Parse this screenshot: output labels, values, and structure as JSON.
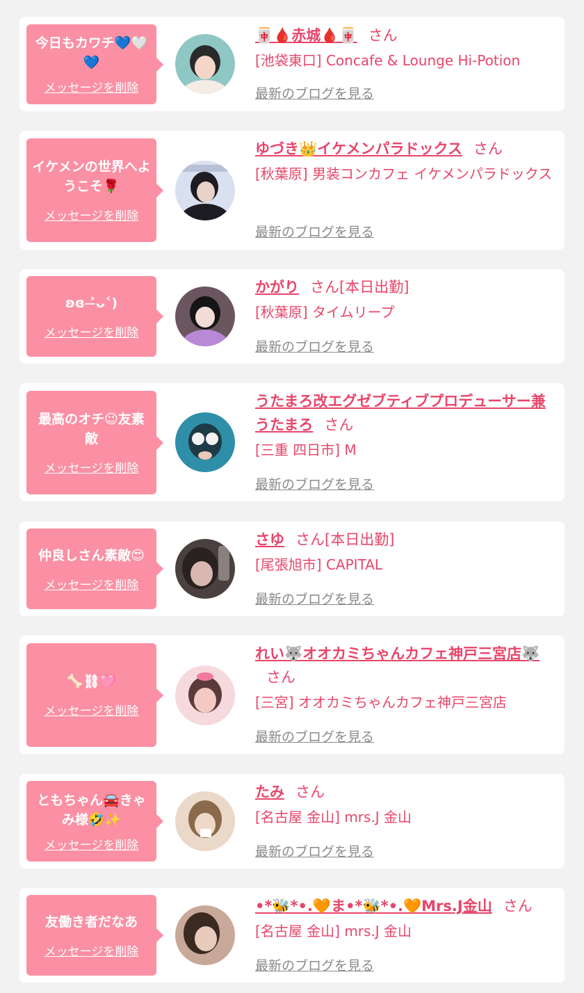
{
  "items": [
    {
      "message": "今日もカワチ💙🤍💙",
      "delete_label": "メッセージを削除",
      "name": "🀄🩸赤城🩸🀄",
      "honorific": "さん",
      "status": "",
      "shop": "[池袋東口] Concafe & Lounge Hi-Potion",
      "blog_label": "最新のブログを見る",
      "avatar_colors": [
        "#8fc7c4",
        "#2a2a2a",
        "#f3d6c7"
      ]
    },
    {
      "message": "イケメンの世界へようこそ🌹",
      "delete_label": "メッセージを削除",
      "name": "ゆづき👑イケメンパラドックス",
      "honorific": "さん",
      "status": "",
      "shop": "[秋葉原] 男装コンカフェ イケメンパラドックス",
      "blog_label": "最新のブログを見る",
      "avatar_colors": [
        "#d9e0ef",
        "#1c1c22",
        "#e9d2c8"
      ]
    },
    {
      "message": "ʚ⁠ɞ ˃̶ᴗ˂)",
      "delete_label": "メッセージを削除",
      "name": "かがり",
      "honorific": "さん",
      "status": "[本日出勤]",
      "shop": "[秋葉原] タイムリープ",
      "blog_label": "最新のブログを見る",
      "avatar_colors": [
        "#6b5660",
        "#151515",
        "#b88ad6"
      ]
    },
    {
      "message": "最高のオチ😉友素敵",
      "delete_label": "メッセージを削除",
      "name": "うたまろ改エグゼブティブプロデューサー兼うたまろ",
      "honorific": "さん",
      "status": "",
      "shop": "[三重 四日市] M",
      "blog_label": "最新のブログを見る",
      "avatar_colors": [
        "#2f8fa8",
        "#1d3a45",
        "#f2f2f2"
      ]
    },
    {
      "message": "仲良しさん素敵😍",
      "delete_label": "メッセージを削除",
      "name": "さゆ",
      "honorific": "さん",
      "status": "[本日出勤]",
      "shop": "[尾張旭市] CAPITAL",
      "blog_label": "最新のブログを見る",
      "avatar_colors": [
        "#4a4040",
        "#2a2222",
        "#d8b8b0"
      ]
    },
    {
      "message": "🦴⛓🩷",
      "delete_label": "メッセージを削除",
      "name": "れい🐺オオカミちゃんカフェ神戸三宮店🐺",
      "honorific": "さん",
      "status": "",
      "shop": "[三宮] オオカミちゃんカフェ神戸三宮店",
      "blog_label": "最新のブログを見る",
      "avatar_colors": [
        "#f6d9dc",
        "#5a3a3a",
        "#f4c9c4"
      ]
    },
    {
      "message": "ともちゃん🚘きゃみ様🤣✨",
      "delete_label": "メッセージを削除",
      "name": "たみ",
      "honorific": "さん",
      "status": "",
      "shop": "[名古屋 金山] mrs.J 金山",
      "blog_label": "最新のブログを見る",
      "avatar_colors": [
        "#ead8c8",
        "#8a6a4a",
        "#f0d8c8"
      ]
    },
    {
      "message": "友働き者だなあ",
      "delete_label": "メッセージを削除",
      "name": "•*🐝*•.🧡ま•*🐝*•.🧡Mrs.J金山",
      "honorific": "さん",
      "status": "",
      "shop": "[名古屋 金山] mrs.J 金山",
      "blog_label": "最新のブログを見る",
      "avatar_colors": [
        "#c8a898",
        "#3a2a22",
        "#e8cbbb"
      ]
    }
  ]
}
